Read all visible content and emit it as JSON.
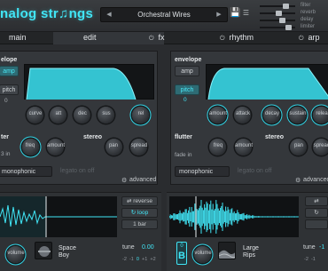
{
  "header": {
    "brand": "nalog str♫ngs",
    "preset_name": "Orchestral Wires",
    "faders": [
      "filter",
      "reverb",
      "delay",
      "limiter"
    ]
  },
  "tabs": [
    {
      "label": "main"
    },
    {
      "label": "edit"
    },
    {
      "label": "fx"
    },
    {
      "label": "rhythm"
    },
    {
      "label": "arp"
    }
  ],
  "left_panel": {
    "envelope_label": "elope",
    "amp": "amp",
    "pitch": "pitch",
    "pitch_value": "0",
    "knobs": [
      "curve",
      "att",
      "dec",
      "sus",
      "rel"
    ],
    "flutter_label": "ter",
    "fade_in": "3 in",
    "freq": "freq",
    "amount": "amount",
    "stereo_label": "stereo",
    "pan": "pan",
    "spread": "spread",
    "mode": "monophonic",
    "legato": "legato on off",
    "advanced": "advanced"
  },
  "right_panel": {
    "envelope_label": "envelope",
    "amp": "amp",
    "pitch": "pitch",
    "pitch_value": "0",
    "knobs": [
      "amount",
      "attack",
      "decay",
      "sustain",
      "relea"
    ],
    "flutter_label": "flutter",
    "fade_in": "fade in",
    "freq": "freq",
    "amount": "amount",
    "stereo_label": "stereo",
    "pan": "pan",
    "spread": "spread",
    "mode": "monophonic",
    "legato": "legato on off",
    "advanced": "advanced"
  },
  "sample_a": {
    "buttons": [
      "reverse",
      "loop",
      "1 bar"
    ],
    "volume": "volume",
    "name_line1": "Space",
    "name_line2": "Boy",
    "tune": "tune",
    "tune_value": "0.00",
    "octaves": [
      "-2",
      "-1",
      "0",
      "+1",
      "+2"
    ]
  },
  "sample_b": {
    "badge_top": "0",
    "badge_letter": "B",
    "volume": "volume",
    "name_line1": "Large",
    "name_line2": "Rips",
    "tune": "tune",
    "tune_value": "-1",
    "octaves": [
      "-2",
      "-1"
    ]
  },
  "colors": {
    "accent": "#41e6f6",
    "panel": "#34373b",
    "background": "#2a2c2f"
  }
}
